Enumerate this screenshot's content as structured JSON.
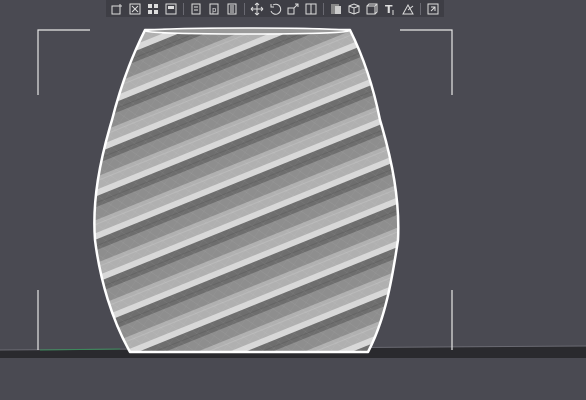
{
  "toolbar": {
    "groups": [
      [
        "add-object",
        "delete",
        "arrange",
        "cut-copy"
      ],
      [
        "layers",
        "copy",
        "paste"
      ],
      [
        "move",
        "rotate",
        "scale",
        "mirror"
      ],
      [
        "select",
        "view-3d",
        "cube",
        "text",
        "support"
      ],
      [
        "settings"
      ]
    ]
  },
  "viewport": {
    "background": "#4a4a52",
    "bed_color": "#2a2a2e",
    "model_color": "#8c8c8c",
    "outline_color": "#ffffff"
  }
}
